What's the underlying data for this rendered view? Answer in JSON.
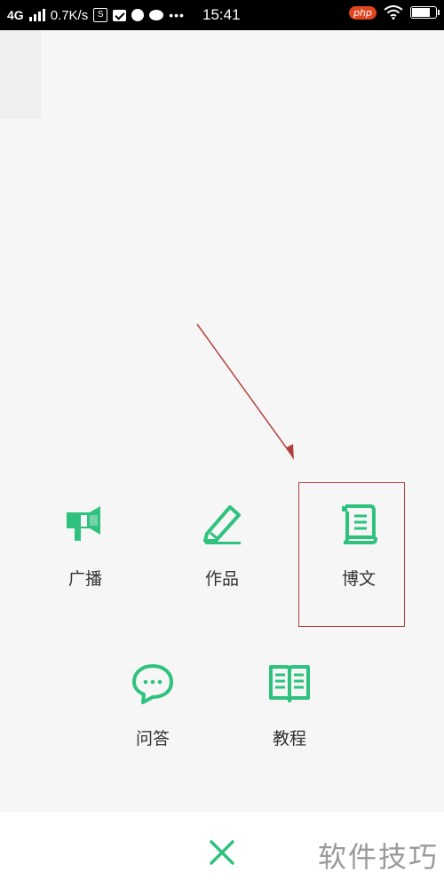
{
  "status_bar": {
    "network": "4G",
    "speed": "0.7K/s",
    "dots": "•••",
    "time": "15:41",
    "icons": [
      "signal-icon",
      "storage-icon",
      "mail-icon",
      "app-icon",
      "chat-icon",
      "wifi-icon",
      "battery-icon"
    ],
    "php_logo": "php",
    "battery_level": 0.85
  },
  "menu": {
    "row1": [
      {
        "label": "广播",
        "icon": "megaphone-icon"
      },
      {
        "label": "作品",
        "icon": "pencil-icon"
      },
      {
        "label": "博文",
        "icon": "scroll-icon"
      }
    ],
    "row2": [
      {
        "label": "问答",
        "icon": "chat-bubble-icon"
      },
      {
        "label": "教程",
        "icon": "book-icon"
      }
    ]
  },
  "bottom": {
    "close_icon": "close-icon",
    "watermark": "软件技巧"
  },
  "colors": {
    "accent": "#2ec27e",
    "annotation": "#b0413e",
    "background": "#f6f6f6"
  }
}
